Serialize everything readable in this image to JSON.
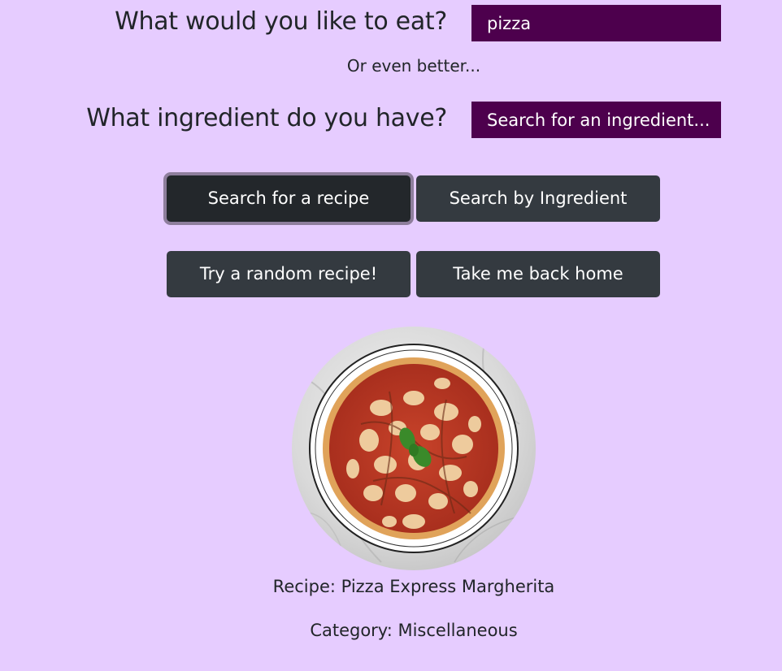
{
  "search": {
    "meal_label": "What would you like to eat?",
    "meal_value": "pizza",
    "or_text": "Or even better...",
    "ingredient_label": "What ingredient do you have?",
    "ingredient_placeholder": "Search for an ingredient..."
  },
  "buttons": {
    "search_recipe": "Search for a recipe",
    "search_ingredient": "Search by Ingredient",
    "random_recipe": "Try a random recipe!",
    "back_home": "Take me back home"
  },
  "result": {
    "image_icon": "pizza-photo",
    "recipe_text": "Recipe: Pizza Express Margherita",
    "category_text": "Category: Miscellaneous"
  },
  "colors": {
    "background": "#e6ccff",
    "input_background": "#4d004d",
    "button_background": "#343a40",
    "text": "#212529"
  }
}
